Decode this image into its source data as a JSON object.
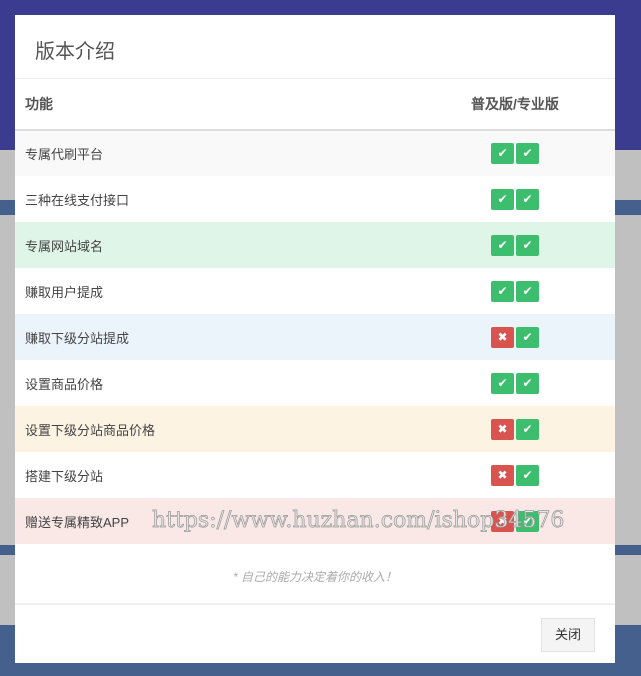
{
  "modal": {
    "title": "版本介绍",
    "footer_note": "* 自己的能力决定着你的收入！",
    "close_label": "关闭"
  },
  "table": {
    "headers": [
      "功能",
      "普及版/专业版"
    ],
    "rows": [
      {
        "feature": "专属代刷平台",
        "basic": true,
        "pro": true
      },
      {
        "feature": "三种在线支付接口",
        "basic": true,
        "pro": true
      },
      {
        "feature": "专属网站域名",
        "basic": true,
        "pro": true
      },
      {
        "feature": "赚取用户提成",
        "basic": true,
        "pro": true
      },
      {
        "feature": "赚取下级分站提成",
        "basic": false,
        "pro": true
      },
      {
        "feature": "设置商品价格",
        "basic": true,
        "pro": true
      },
      {
        "feature": "设置下级分站商品价格",
        "basic": false,
        "pro": true
      },
      {
        "feature": "搭建下级分站",
        "basic": false,
        "pro": true
      },
      {
        "feature": "赠送专属精致APP",
        "basic": false,
        "pro": true
      }
    ],
    "row_colors": [
      "#f9f9f9",
      "#ffffff",
      "#dff5e8",
      "#ffffff",
      "#ebf4fb",
      "#ffffff",
      "#fcf3e3",
      "#ffffff",
      "#f9e8e6"
    ]
  },
  "icons": {
    "yes": "check-icon",
    "no": "x-icon"
  },
  "watermark": "https://www.huzhan.com/ishop34576"
}
